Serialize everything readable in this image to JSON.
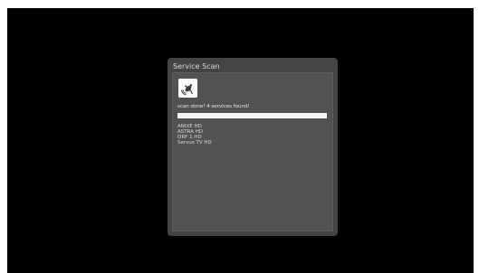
{
  "dialog": {
    "title": "Service Scan",
    "icon": "satellite-dish-icon",
    "status": "scan done! 4 services found!",
    "progress": 1.0,
    "services": [
      "ANIXE HD",
      "ASTRA HD",
      "ORF 1 HD",
      "Servus TV HD"
    ]
  },
  "colors": {
    "screen_background": "#000000",
    "dialog_background": "#444444",
    "panel_background": "#525252",
    "progress_fill": "#f4f4f4"
  }
}
